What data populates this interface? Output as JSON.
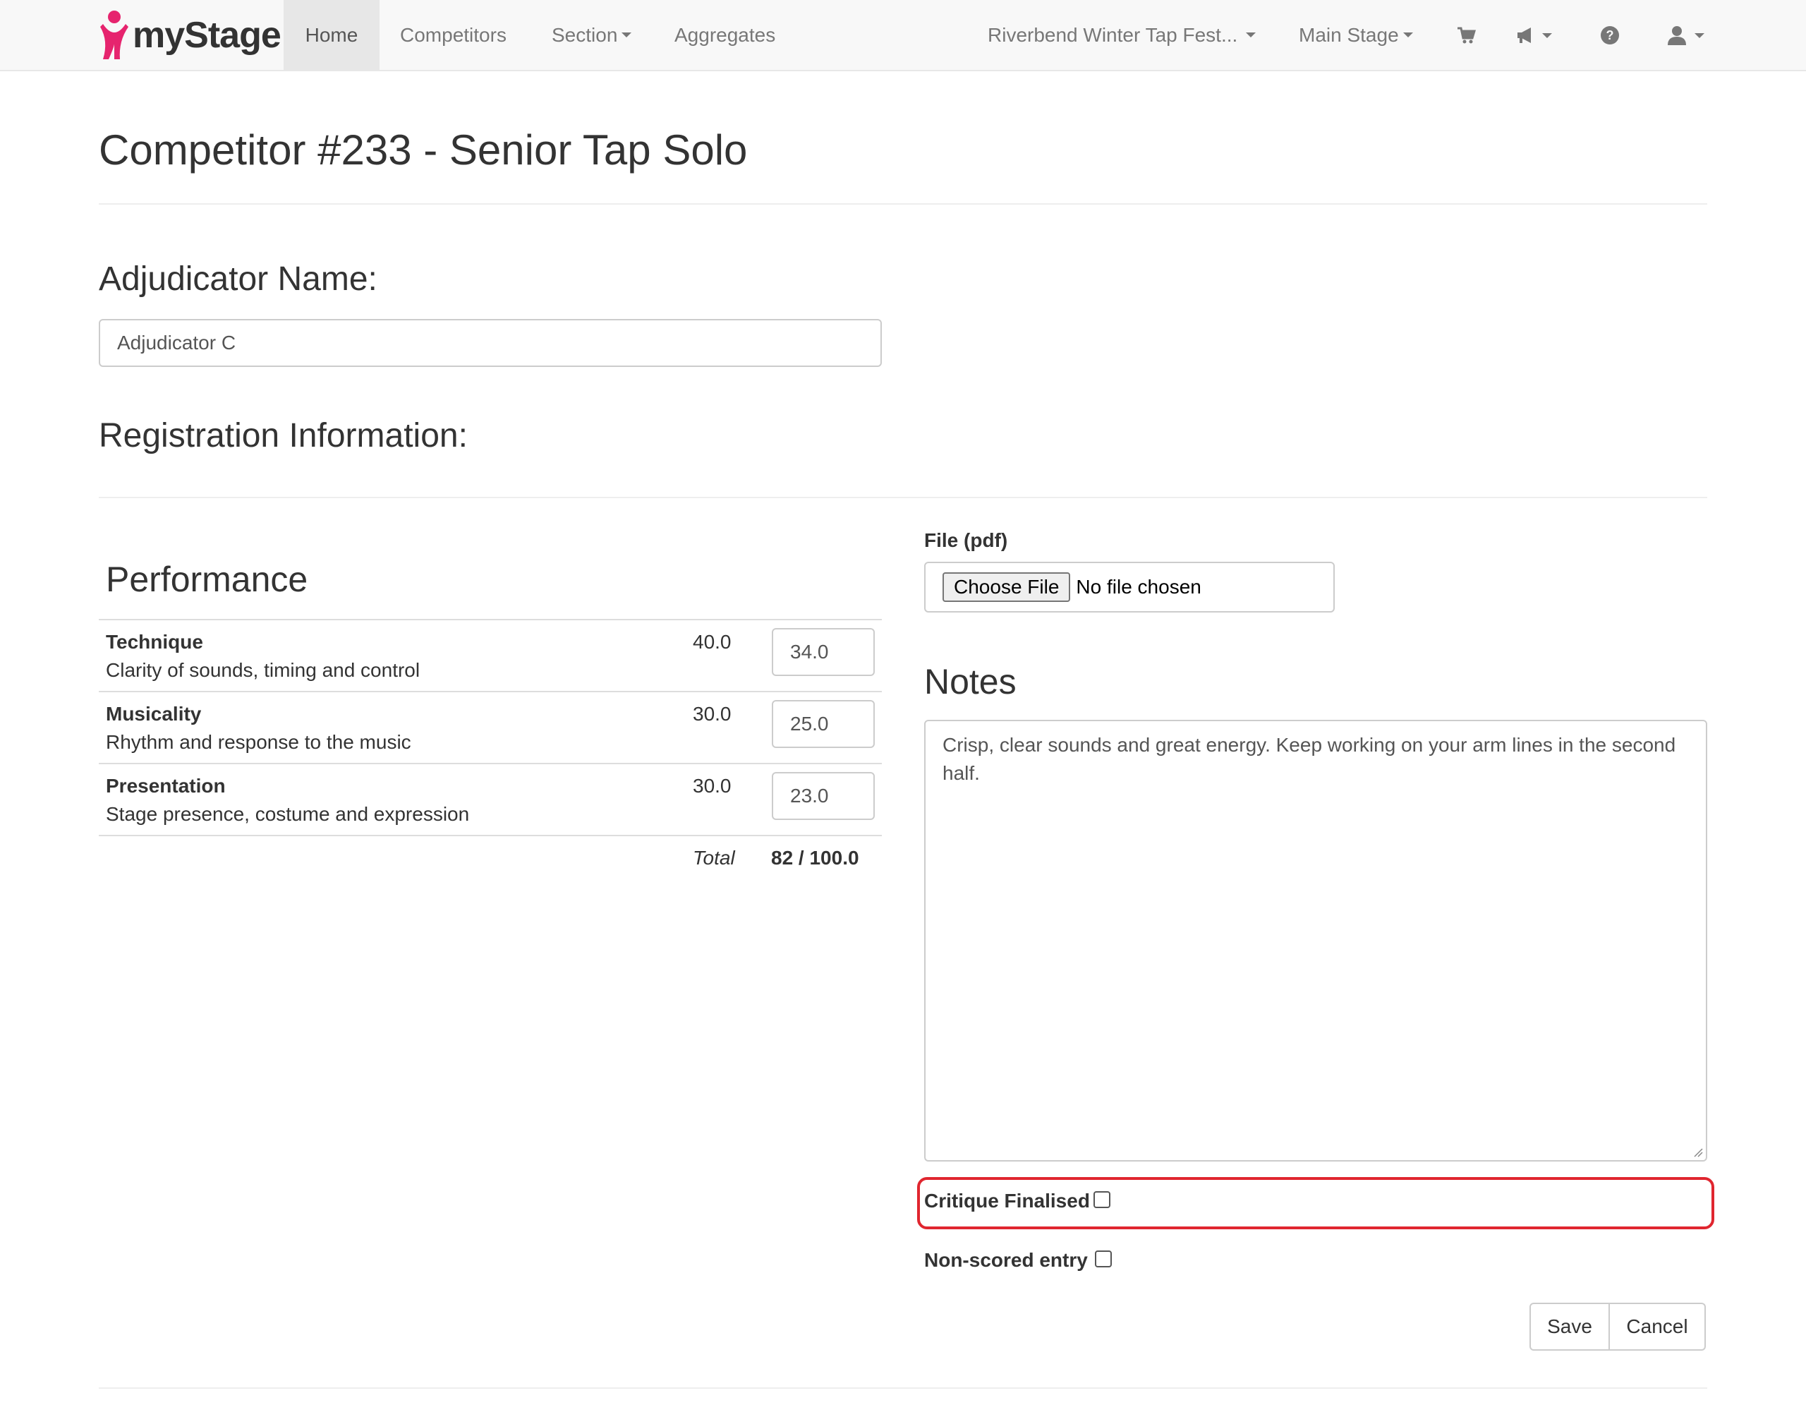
{
  "navbar": {
    "brand": "myStage",
    "links": [
      {
        "label": "Home",
        "active": true
      },
      {
        "label": "Competitors"
      },
      {
        "label": "Section"
      },
      {
        "label": "Aggregates"
      }
    ],
    "event_selector": "Riverbend Winter Tap Fest...",
    "stage_selector": "Main Stage",
    "icons": [
      "cart-icon",
      "megaphone-icon",
      "help-icon",
      "user-icon"
    ],
    "brand_color": "#e6246e"
  },
  "page": {
    "title": "Competitor #233 - Senior Tap Solo"
  },
  "adjudicator": {
    "heading": "Adjudicator Name:",
    "value": "Adjudicator C"
  },
  "registration": {
    "heading": "Registration Information:"
  },
  "performance": {
    "title": "Performance",
    "criteria": [
      {
        "name": "Technique",
        "desc": "Clarity of sounds, timing and control",
        "max": "40.0",
        "score": "34.0"
      },
      {
        "name": "Musicality",
        "desc": "Rhythm and response to the music",
        "max": "30.0",
        "score": "25.0"
      },
      {
        "name": "Presentation",
        "desc": "Stage presence, costume and expression",
        "max": "30.0",
        "score": "23.0"
      }
    ],
    "total_label": "Total",
    "total_value": "82 / 100.0"
  },
  "file": {
    "label": "File (pdf)",
    "button": "Choose File",
    "status": "No file chosen"
  },
  "notes": {
    "title": "Notes",
    "text": "Crisp, clear sounds and great energy. Keep working on your arm lines in the second half."
  },
  "options": {
    "critique_finalised": {
      "label": "Critique Finalised",
      "checked": false
    },
    "non_scored": {
      "label": "Non-scored entry",
      "checked": false
    },
    "highlight_color": "#e0262f"
  },
  "actions": {
    "save": "Save",
    "cancel": "Cancel"
  }
}
